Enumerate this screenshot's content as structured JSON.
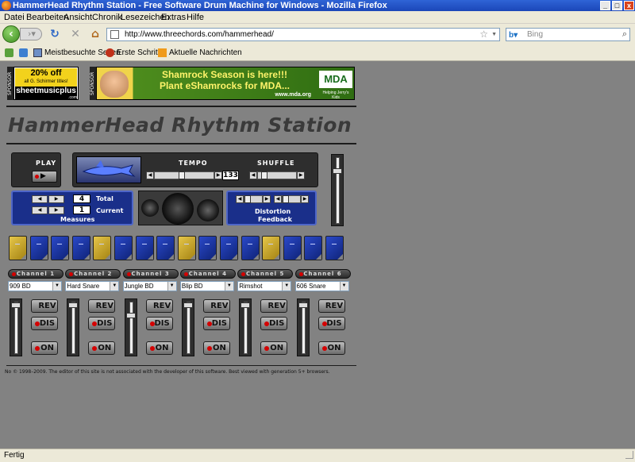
{
  "window": {
    "title": "HammerHead Rhythm Station - Free Software Drum Machine for Windows - Mozilla Firefox",
    "min": "_",
    "max": "□",
    "close": "x"
  },
  "menu": [
    "Datei",
    "Bearbeiten",
    "Ansicht",
    "Chronik",
    "Lesezeichen",
    "Extras",
    "Hilfe"
  ],
  "nav": {
    "url": "http://www.threechords.com/hammerhead/",
    "search_placeholder": "Bing"
  },
  "bookmarks": [
    "Meistbesuchte Seiten",
    "Erste Schritte",
    "Aktuelle Nachrichten"
  ],
  "ads": {
    "sponsor_label": "SPONSOR",
    "ad1": {
      "line1": "20% off",
      "line2": "all G. Schirmer titles!",
      "brand": "sheetmusicplus",
      "domain": ".com"
    },
    "ad2": {
      "line1": "Shamrock Season is here!!!",
      "line2": "Plant eShamrocks for MDA...",
      "url": "www.mda.org",
      "brand": "MDA",
      "tagline": "Helping Jerry's Kids"
    }
  },
  "page": {
    "logo": "HammerHead Rhythm Station",
    "play": "PLAY",
    "play_icon": "▶",
    "tempo_label": "TEMPO",
    "tempo_value": "133",
    "tempo_level": 0.45,
    "shuffle_label": "SHUFFLE",
    "shuffle_level": 0.1,
    "measures": {
      "total_value": "4",
      "total_label": "Total",
      "current_value": "1",
      "current_label": "Current",
      "label": "Measures"
    },
    "effects": {
      "distortion": "Distortion",
      "feedback": "Feedback"
    },
    "master_volume_level": 0.8
  },
  "channels": [
    {
      "label": "Channel 1",
      "sound": "909 BD",
      "volume_level": 0.95,
      "rev": "REV",
      "dis": "DIS",
      "on": "ON"
    },
    {
      "label": "Channel 2",
      "sound": "Hard Snare",
      "volume_level": 0.95,
      "rev": "REV",
      "dis": "DIS",
      "on": "ON"
    },
    {
      "label": "Channel 3",
      "sound": "Jungle BD",
      "volume_level": 0.75,
      "rev": "REV",
      "dis": "DIS",
      "on": "ON"
    },
    {
      "label": "Channel 4",
      "sound": "Blip BD",
      "volume_level": 0.95,
      "rev": "REV",
      "dis": "DIS",
      "on": "ON"
    },
    {
      "label": "Channel 5",
      "sound": "Rimshot",
      "volume_level": 0.95,
      "rev": "REV",
      "dis": "DIS",
      "on": "ON"
    },
    {
      "label": "Channel 6",
      "sound": "606 Snare",
      "volume_level": 0.95,
      "rev": "REV",
      "dis": "DIS",
      "on": "ON"
    }
  ],
  "steps": [
    "gold",
    "blue",
    "blue",
    "blue",
    "gold",
    "blue",
    "blue",
    "blue",
    "gold",
    "blue",
    "blue",
    "blue",
    "gold",
    "blue",
    "blue",
    "blue"
  ],
  "footer": "No © 1998–2009. The editor of this site is not associated with the developer of this software. Best viewed with generation 5+ browsers.",
  "status": "Fertig"
}
